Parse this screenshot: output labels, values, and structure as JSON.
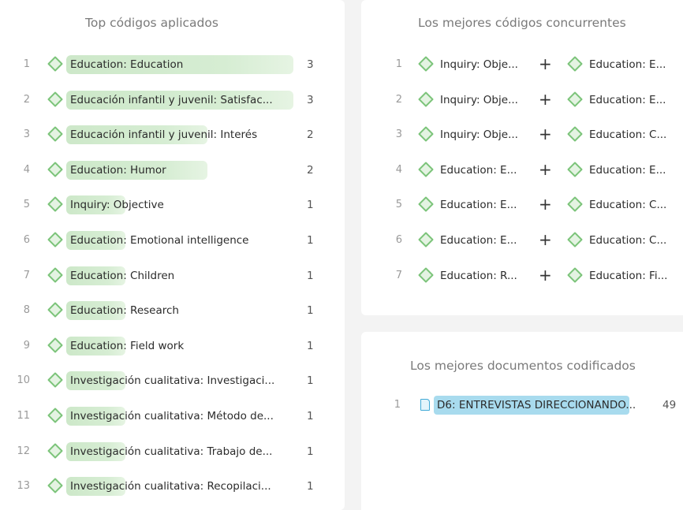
{
  "top_codes": {
    "title": "Top códigos aplicados",
    "items": [
      {
        "rank": "1",
        "label": "Education: Education",
        "count": "3",
        "fill": 1.0
      },
      {
        "rank": "2",
        "label": "Educación infantil y juvenil: Satisfac...",
        "count": "3",
        "fill": 1.0
      },
      {
        "rank": "3",
        "label": "Educación infantil y juvenil: Interés",
        "count": "2",
        "fill": 0.62
      },
      {
        "rank": "4",
        "label": "Education: Humor",
        "count": "2",
        "fill": 0.62
      },
      {
        "rank": "5",
        "label": "Inquiry: Objective",
        "count": "1",
        "fill": 0.26
      },
      {
        "rank": "6",
        "label": "Education: Emotional intelligence",
        "count": "1",
        "fill": 0.26
      },
      {
        "rank": "7",
        "label": "Education: Children",
        "count": "1",
        "fill": 0.26
      },
      {
        "rank": "8",
        "label": "Education: Research",
        "count": "1",
        "fill": 0.26
      },
      {
        "rank": "9",
        "label": "Education: Field work",
        "count": "1",
        "fill": 0.26
      },
      {
        "rank": "10",
        "label": "Investigación cualitativa: Investigaci...",
        "count": "1",
        "fill": 0.26
      },
      {
        "rank": "11",
        "label": "Investigación cualitativa: Método de...",
        "count": "1",
        "fill": 0.26
      },
      {
        "rank": "12",
        "label": "Investigación cualitativa: Trabajo de...",
        "count": "1",
        "fill": 0.26
      },
      {
        "rank": "13",
        "label": "Investigación cualitativa: Recopilaci...",
        "count": "1",
        "fill": 0.26
      }
    ]
  },
  "co_occurring": {
    "title": "Los mejores códigos concurrentes",
    "items": [
      {
        "rank": "1",
        "code_a": "Inquiry: Obje...",
        "code_b": "Education: E..."
      },
      {
        "rank": "2",
        "code_a": "Inquiry: Obje...",
        "code_b": "Education: E..."
      },
      {
        "rank": "3",
        "code_a": "Inquiry: Obje...",
        "code_b": "Education: C..."
      },
      {
        "rank": "4",
        "code_a": "Education: E...",
        "code_b": "Education: E..."
      },
      {
        "rank": "5",
        "code_a": "Education: E...",
        "code_b": "Education: C..."
      },
      {
        "rank": "6",
        "code_a": "Education: E...",
        "code_b": "Education: C..."
      },
      {
        "rank": "7",
        "code_a": "Education: R...",
        "code_b": "Education: Fi..."
      }
    ],
    "plus_symbol": "+"
  },
  "top_documents": {
    "title": "Los mejores documentos codificados",
    "items": [
      {
        "rank": "1",
        "label": "D6: ENTREVISTAS DIRECCIONANDO...",
        "count": "49"
      }
    ]
  },
  "icons": {
    "code": "diamond-code-icon",
    "document": "document-icon"
  },
  "colors": {
    "code_icon": "#7cc47a",
    "code_bar": "#cde8c9",
    "document_bar": "#a8dbee",
    "document_icon": "#3fa9d6"
  }
}
